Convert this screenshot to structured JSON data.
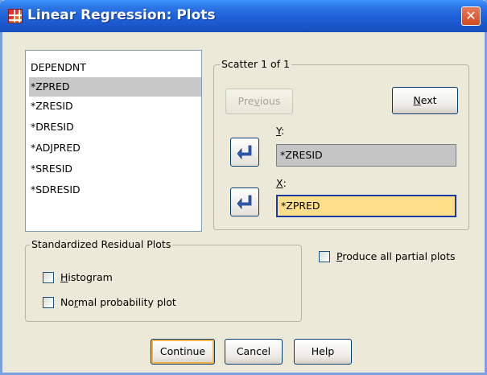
{
  "window": {
    "title": "Linear Regression: Plots",
    "close_symbol": "✕"
  },
  "variable_list": {
    "items": [
      "DEPENDNT",
      "*ZPRED",
      "*ZRESID",
      "*DRESID",
      "*ADJPRED",
      "*SRESID",
      "*SDRESID"
    ],
    "selected_index": 1
  },
  "scatter": {
    "legend": "Scatter 1 of 1",
    "previous_label": "Previous",
    "next_label": "Next",
    "y_label": "Y:",
    "y_value": "*ZRESID",
    "x_label": "X:",
    "x_value": "*ZPRED"
  },
  "residual_plots": {
    "legend": "Standardized Residual Plots",
    "histogram_label": "Histogram",
    "histogram_checked": false,
    "normal_label": "Normal probability plot",
    "normal_checked": false
  },
  "partial_plots": {
    "label": "Produce all partial plots",
    "checked": false
  },
  "buttons": {
    "continue": "Continue",
    "cancel": "Cancel",
    "help": "Help"
  },
  "colors": {
    "title_bar": "#1e5fd8",
    "dialog_background": "#ece9d8",
    "x_field_highlight": "#ffe08a",
    "selected_item": "#c8c8c8"
  }
}
